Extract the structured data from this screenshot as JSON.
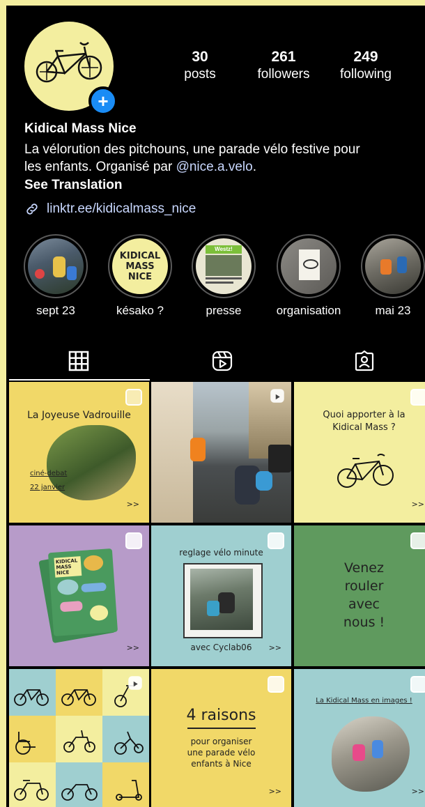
{
  "profile": {
    "name": "Kidical Mass Nice",
    "bio_line1": "La vélorution des pitchouns, une parade vélo festive pour",
    "bio_line2_prefix": "les enfants. Organisé par ",
    "bio_mention": "@nice.a.velo",
    "bio_line2_suffix": ".",
    "see_translation": "See Translation",
    "link": "linktr.ee/kidicalmass_nice"
  },
  "stats": {
    "posts": {
      "value": "30",
      "label": "posts"
    },
    "followers": {
      "value": "261",
      "label": "followers"
    },
    "following": {
      "value": "249",
      "label": "following"
    }
  },
  "highlights": [
    {
      "label": "sept 23"
    },
    {
      "label": "késako ?",
      "cover_text": "KIDICAL MASS NICE"
    },
    {
      "label": "presse",
      "cover_text": "Westz!"
    },
    {
      "label": "organisation"
    },
    {
      "label": "mai 23"
    }
  ],
  "tabs": [
    "grid-icon",
    "reels-icon",
    "tagged-icon"
  ],
  "posts": [
    {
      "title": "La Joyeuse Vadrouille",
      "line1": "ciné-debat",
      "line2": "22 janvier",
      "more": ">>",
      "bg": "#f1d868"
    },
    {
      "bg": "#8a8a8a"
    },
    {
      "title": "Quoi apporter à la",
      "title2": "Kidical Mass ?",
      "more": ">>",
      "bg": "#f3ee9f"
    },
    {
      "more": ">>",
      "bg": "#b79bc9",
      "card_text": "KIDICAL MASS NICE"
    },
    {
      "title": "reglage vélo minute",
      "caption": "avec Cyclab06",
      "more": ">>",
      "bg": "#9fcfd0"
    },
    {
      "line1": "Venez",
      "line2": "rouler",
      "line3": "avec",
      "line4": "nous !",
      "bg": "#5f9a5e"
    },
    {
      "bg": "#9fcfd0"
    },
    {
      "title": "4 raisons",
      "line1": "pour organiser",
      "line2": "une parade vélo",
      "line3": "enfants à Nice",
      "more": ">>",
      "bg": "#f1d868"
    },
    {
      "title": "La Kidical Mass en images !",
      "more": ">>",
      "bg": "#9fcfd0"
    }
  ],
  "colors": {
    "accent_blue": "#1a8cf5",
    "link": "#c9d8ff",
    "page_bg": "#f3ee9f"
  }
}
